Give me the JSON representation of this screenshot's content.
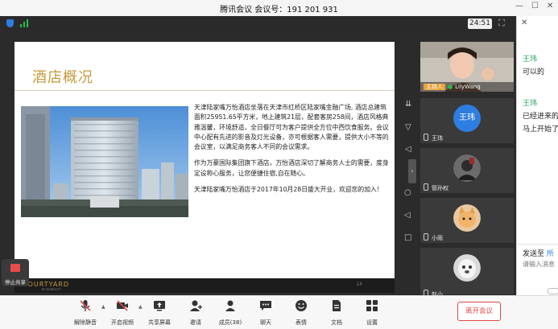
{
  "window": {
    "title": "腾讯会议 会议号：191 201 931",
    "minimize": "—",
    "maximize": "☐",
    "close": "✕"
  },
  "meeting": {
    "timer": "24:51",
    "fullscreen_icon": "fullscreen-icon"
  },
  "slide": {
    "title": "酒店概况",
    "paragraphs": [
      "天津陆家嘴万怡酒店坐落在天津市红桥区陆家嘴金融广场, 酒店总建筑面积25951.65平方米，地上建筑21层，配套客房258间，酒店风格典雅温馨，环境舒适，全日餐厅可为客户提供全方位中西饮食服务。会议中心配有先进的影音及灯光设备，亦可根据客人需要，提供大小不等的会议室，以满足商务客人不同的会议需求。",
      "作为万豪国际集团旗下酒店，万怡酒店深切了解商务人士的需要，度身定设称心服务，让您便捷住宿,自在随心。",
      "天津陆家嘴万怡酒店于2017年10月28日盛大开业，欢迎您的加入！"
    ],
    "brand": "COURTYARD",
    "brand_sub": "BY MARRIOTT",
    "page": "14"
  },
  "share": {
    "stop_label": "停止共享"
  },
  "participants": [
    {
      "name": "LilyWang",
      "badge": "主持人",
      "type": "video"
    },
    {
      "name": "王玮",
      "avatar_text": "王玮",
      "avatar_color": "#2e7de0"
    },
    {
      "name": "管孙权",
      "type": "photo"
    },
    {
      "name": "小雨",
      "type": "cat"
    },
    {
      "name": "赵小",
      "type": "dog"
    }
  ],
  "toolbar": {
    "mute": "解除静音",
    "video": "开启视频",
    "share": "共享屏幕",
    "invite": "邀请",
    "members": "成员(38)",
    "chat": "聊天",
    "reactions": "表情",
    "docs": "文档",
    "settings": "设置",
    "leave": "离开会议"
  },
  "chat": {
    "messages": [
      {
        "sender": "王玮",
        "lines": [
          "可以的"
        ]
      },
      {
        "sender": "王玮",
        "lines": [
          "已经进来的",
          "马上开始了"
        ]
      }
    ],
    "send_to_label": "发送至",
    "send_to_target": "所",
    "input_placeholder": "请输入消息"
  },
  "colors": {
    "accent_gold": "#c59a3c",
    "leave_red": "#e04a4a",
    "chat_name_green": "#27a35a",
    "signal_green": "#27c04b"
  }
}
